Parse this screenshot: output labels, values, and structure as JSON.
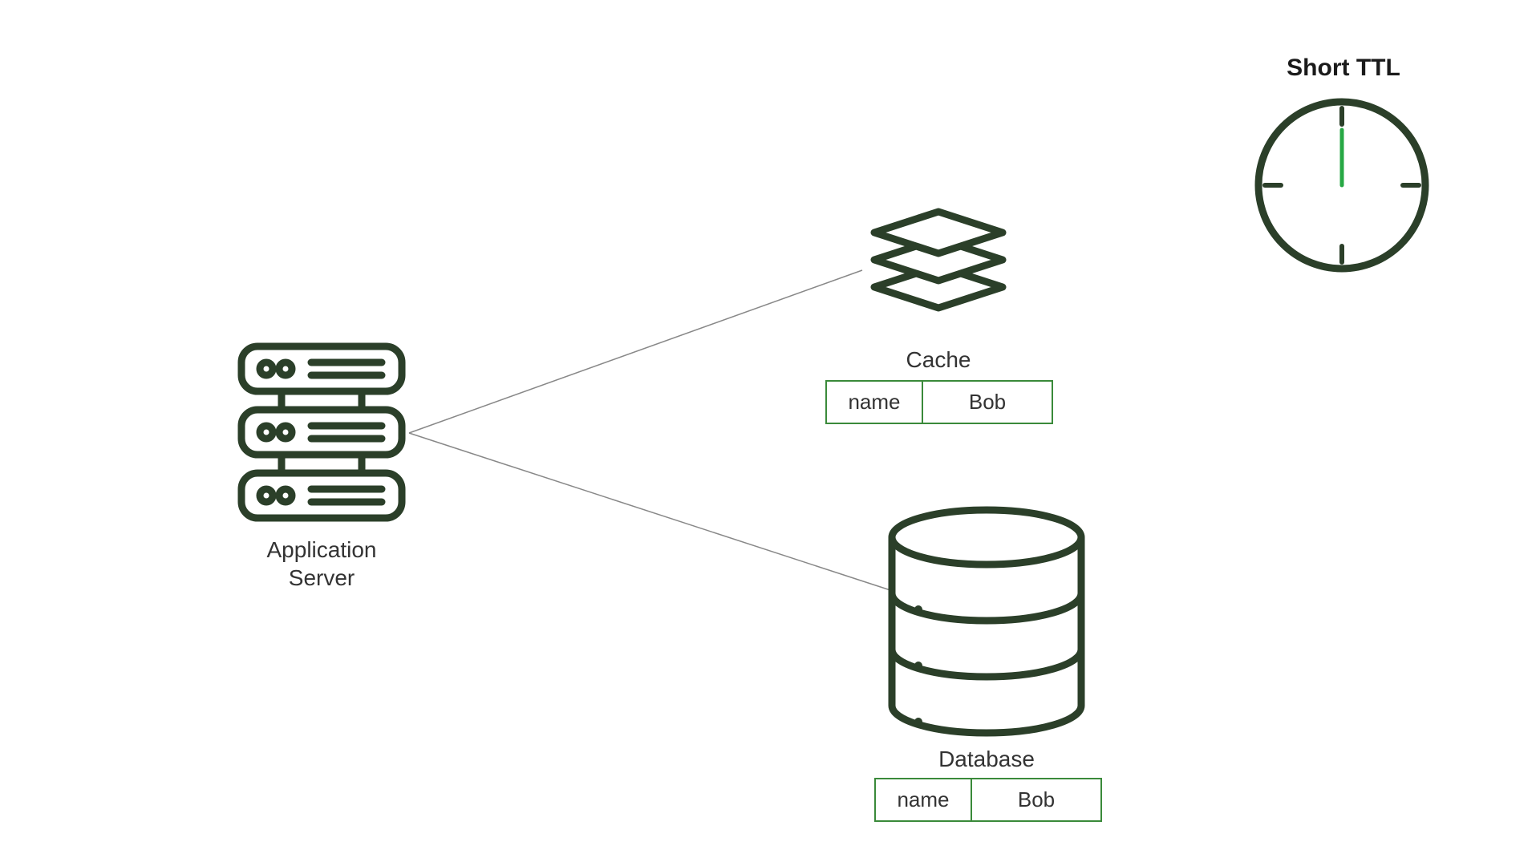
{
  "colors": {
    "stroke": "#2b3f29",
    "tableBorder": "#3a8a3a",
    "connector": "#777",
    "accent": "#27a844"
  },
  "ttl": {
    "label": "Short TTL"
  },
  "server": {
    "label_line1": "Application",
    "label_line2": "Server"
  },
  "cache": {
    "label": "Cache",
    "key": "name",
    "value": "Bob"
  },
  "database": {
    "label": "Database",
    "key": "name",
    "value": "Bob"
  }
}
